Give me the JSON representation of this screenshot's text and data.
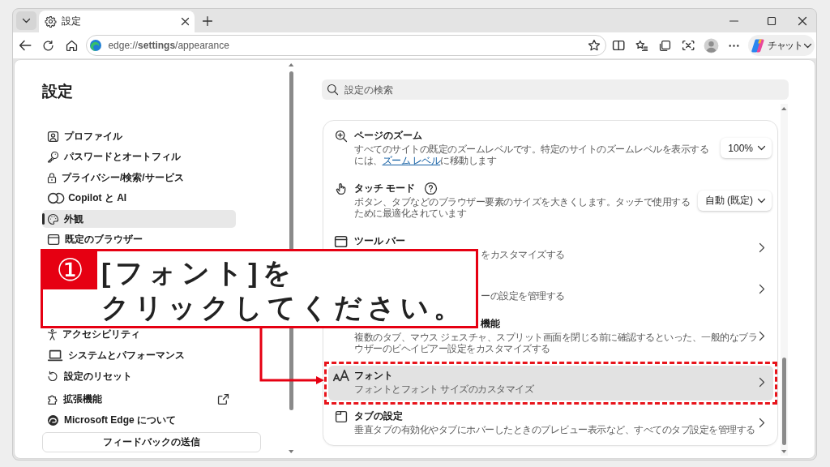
{
  "browser": {
    "tab": {
      "title": "設定"
    },
    "address_bar": {
      "url": "edge://**settings**/appearance"
    },
    "chat_button": {
      "label": "チャット"
    }
  },
  "sidebar": {
    "title": "設定",
    "groups": [
      {
        "items": [
          {
            "label": "プロファイル",
            "selected": false
          },
          {
            "label": "パスワードとオートフィル",
            "selected": false
          },
          {
            "label": "プライバシー/検索/サービス",
            "selected": false
          },
          {
            "label": "Copilot と AI",
            "selected": false
          },
          {
            "label": "外観",
            "selected": true
          },
          {
            "label": "既定のブラウザー",
            "selected": false
          }
        ]
      },
      {
        "items": [
          {
            "label": "アクセシビリティ",
            "selected": false
          },
          {
            "label": "システムとパフォーマンス",
            "selected": false
          },
          {
            "label": "設定のリセット",
            "selected": false
          }
        ]
      },
      {
        "items": [
          {
            "label": "拡張機能",
            "selected": false
          },
          {
            "label": "Microsoft Edge について",
            "selected": false
          }
        ]
      }
    ],
    "feedback_button": "フィードバックの送信"
  },
  "content": {
    "search": {
      "placeholder": "設定の検索"
    },
    "rows": [
      {
        "title": "ページのズーム",
        "title_covered": false,
        "description": [
          {
            "kind": "text",
            "text": "すべてのサイトの既定のズームレベルです。特定のサイトのズームレベルを表示するには、"
          },
          {
            "kind": "link",
            "text": "ズーム レベル"
          },
          {
            "kind": "text",
            "text": "に移動します"
          }
        ],
        "description_covered": false,
        "control": {
          "kind": "dropdown",
          "value": "100%"
        },
        "highlighted": false
      },
      {
        "title": "タッチ モード",
        "title_covered": false,
        "description": [
          {
            "kind": "text",
            "text": "ボタン、タブなどのブラウザー要素のサイズを大きくします。タッチで使用するために最適化されています"
          }
        ],
        "description_covered": false,
        "control": {
          "kind": "dropdown",
          "value": "自動 (既定)"
        },
        "highlighted": false
      },
      {
        "title": "ツール バー",
        "title_covered": false,
        "description": [
          {
            "kind": "text",
            "text": "をカスタマイズする"
          }
        ],
        "description_covered": true,
        "control": {
          "kind": "chevron"
        },
        "highlighted": false
      },
      {
        "description": [
          {
            "kind": "text",
            "text": "ーの設定を管理する"
          }
        ],
        "description_covered": true,
        "control": {
          "kind": "chevron"
        },
        "highlighted": false
      },
      {
        "title": "機能",
        "title_covered": true,
        "description": [
          {
            "kind": "text",
            "text": "複数のタブ、マウス ジェスチャ、スプリット画面を閉じる前に確認するといった、一般的なブラウザーのビヘイビアー設定をカスタマイズする"
          }
        ],
        "description_covered": false,
        "control": {
          "kind": "chevron"
        },
        "highlighted": false
      },
      {
        "title": "フォント",
        "title_covered": false,
        "description": [
          {
            "kind": "text",
            "text": "フォントとフォント サイズのカスタマイズ"
          }
        ],
        "description_covered": false,
        "control": {
          "kind": "chevron"
        },
        "highlighted": true
      },
      {
        "title": "タブの設定",
        "title_covered": false,
        "description": [
          {
            "kind": "text",
            "text": "垂直タブの有効化やタブにホバーしたときのプレビュー表示など、すべてのタブ設定を管理する"
          }
        ],
        "description_covered": false,
        "control": {
          "kind": "chevron"
        },
        "highlighted": false
      }
    ]
  },
  "callout": {
    "number": "①",
    "lines": [
      "[フォント]を",
      "クリックしてください。"
    ]
  }
}
